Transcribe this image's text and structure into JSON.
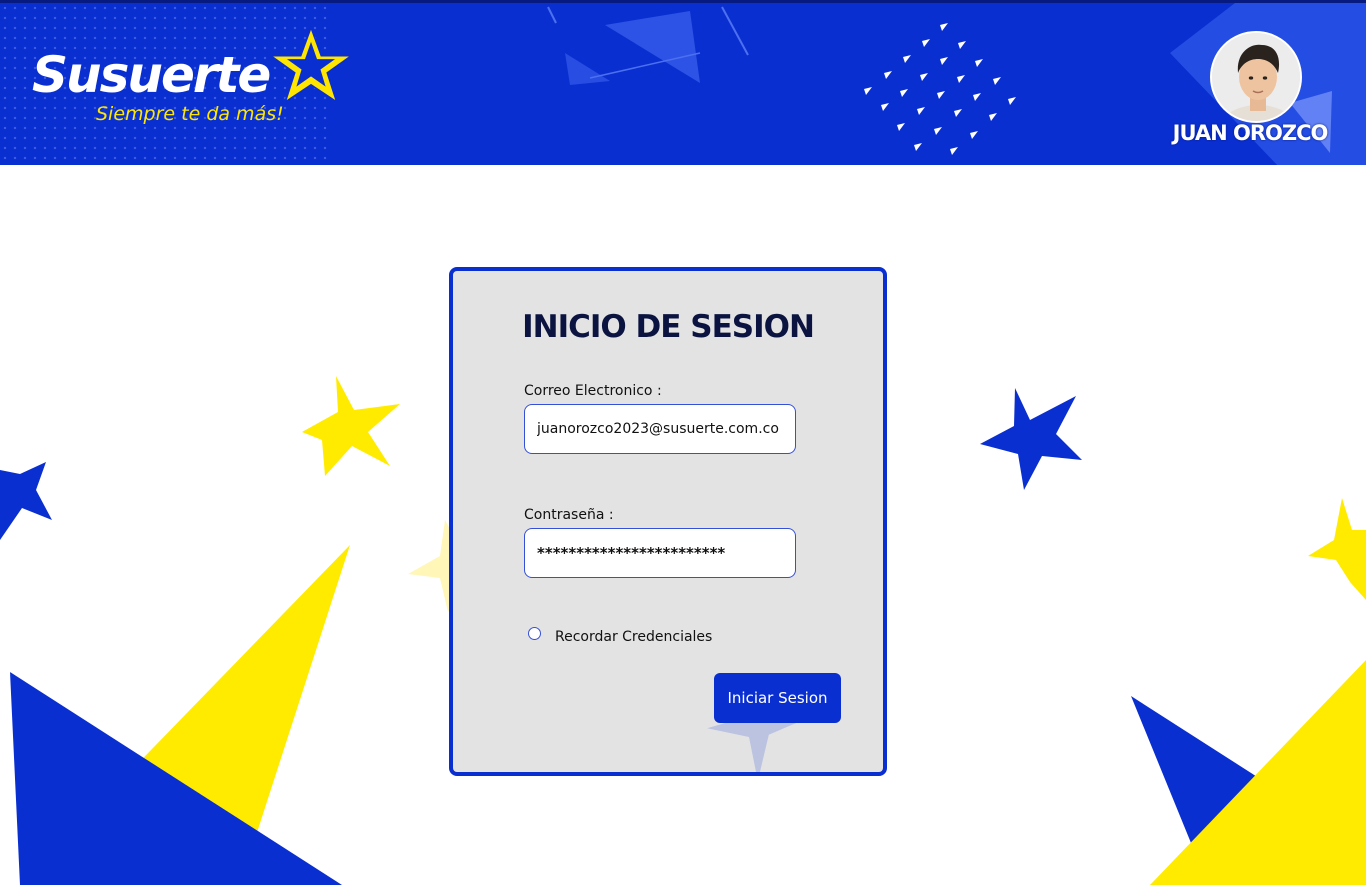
{
  "brand": {
    "name": "Susuerte",
    "tagline": "Siempre te da más!",
    "primary_color": "#0a2fd0",
    "accent_color": "#ffe600"
  },
  "user": {
    "name": "JUAN OROZCO",
    "avatar_icon": "user-avatar"
  },
  "login": {
    "title": "INICIO DE SESION",
    "email_label": "Correo Electronico :",
    "email_value": "juanorozco2023@susuerte.com.co",
    "password_label": "Contraseña :",
    "password_value": "************************",
    "remember_label": "Recordar Credenciales",
    "remember_checked": false,
    "submit_label": "Iniciar Sesion"
  }
}
